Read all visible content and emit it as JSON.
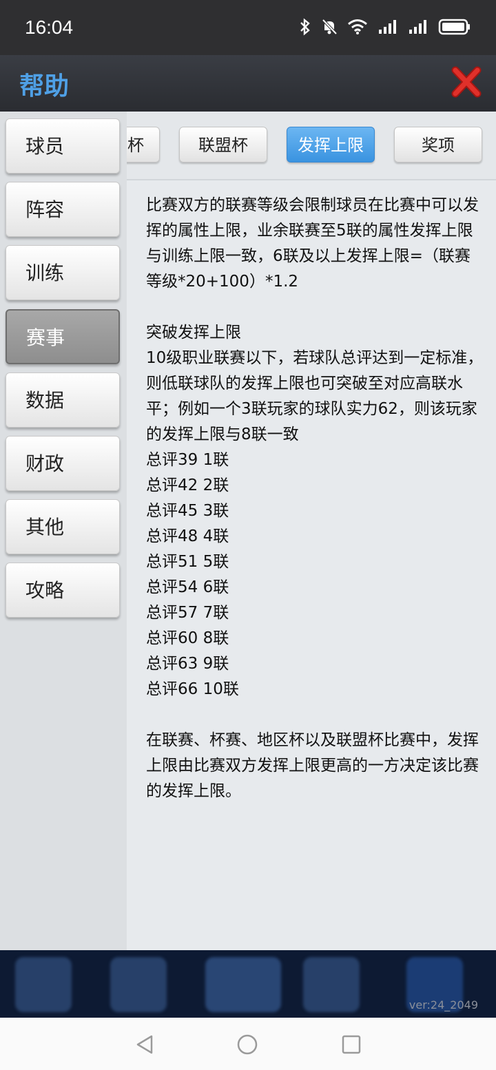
{
  "status": {
    "time": "16:04"
  },
  "header": {
    "title": "帮助"
  },
  "sidebar": {
    "items": [
      {
        "label": "球员"
      },
      {
        "label": "阵容"
      },
      {
        "label": "训练"
      },
      {
        "label": "赛事",
        "active": true
      },
      {
        "label": "数据"
      },
      {
        "label": "财政"
      },
      {
        "label": "其他"
      },
      {
        "label": "攻略"
      }
    ]
  },
  "tabs": [
    {
      "label": "杯"
    },
    {
      "label": "联盟杯"
    },
    {
      "label": "发挥上限",
      "active": true
    },
    {
      "label": "奖项"
    }
  ],
  "content": {
    "intro": "比赛双方的联赛等级会限制球员在比赛中可以发挥的属性上限，业余联赛至5联的属性发挥上限与训练上限一致，6联及以上发挥上限=（联赛等级*20+100）*1.2",
    "section_title": "突破发挥上限",
    "section_text": "10级职业联赛以下，若球队总评达到一定标准，则低联球队的发挥上限也可突破至对应高联水平；例如一个3联玩家的球队实力62，则该玩家的发挥上限与8联一致",
    "ratings": [
      "总评39  1联",
      "总评42  2联",
      "总评45  3联",
      "总评48  4联",
      "总评51  5联",
      "总评54  6联",
      "总评57  7联",
      "总评60  8联",
      "总评63  9联",
      "总评66  10联"
    ],
    "outro": "在联赛、杯赛、地区杯以及联盟杯比赛中，发挥上限由比赛双方发挥上限更高的一方决定该比赛的发挥上限。"
  },
  "footer": {
    "version": "ver:24_2049"
  },
  "colors": {
    "accent": "#3a93e0",
    "title": "#4fa0e6",
    "close": "#e0302a"
  }
}
